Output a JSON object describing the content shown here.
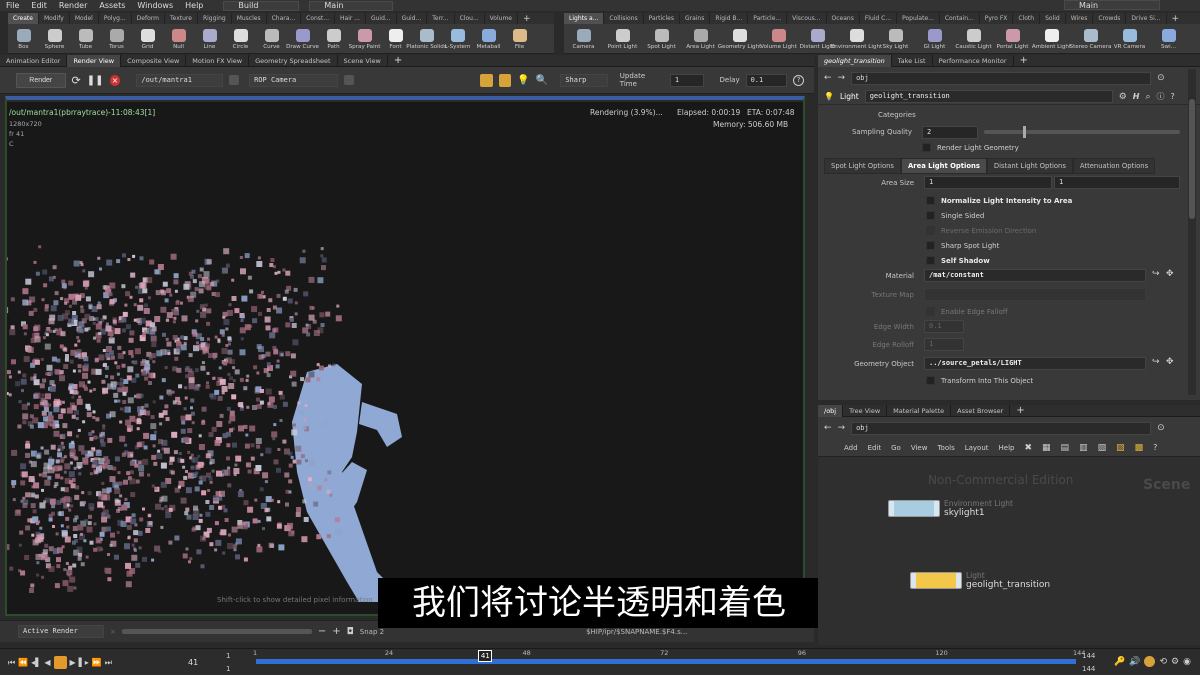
{
  "menubar": {
    "items": [
      "File",
      "Edit",
      "Render",
      "Assets",
      "Windows",
      "Help"
    ],
    "desktop": "Build",
    "layout": "Main",
    "right_layout": "Main"
  },
  "shelf_left": {
    "tabs": [
      "Create",
      "Modify",
      "Model",
      "Polyg...",
      "Deform",
      "Texture",
      "Rigging",
      "Muscles",
      "Chara...",
      "Const...",
      "Hair ...",
      "Guid...",
      "Guid...",
      "Terr...",
      "Clou...",
      "Volume"
    ],
    "tools": [
      "Box",
      "Sphere",
      "Tube",
      "Torus",
      "Grid",
      "Null",
      "Line",
      "Circle",
      "Curve",
      "Draw Curve",
      "Path",
      "Spray Paint",
      "Font",
      "Platonic Solids",
      "L-System",
      "Metaball",
      "File"
    ]
  },
  "shelf_right": {
    "tabs": [
      "Lights a...",
      "Collisions",
      "Particles",
      "Grains",
      "Rigid B...",
      "Particle...",
      "Viscous...",
      "Oceans",
      "Fluid C...",
      "Populate...",
      "Contain...",
      "Pyro FX",
      "Cloth",
      "Solid",
      "Wires",
      "Crowds",
      "Drive Si..."
    ],
    "tools": [
      "Camera",
      "Point Light",
      "Spot Light",
      "Area Light",
      "Geometry Light",
      "Volume Light",
      "Distant Light",
      "Environment Light",
      "Sky Light",
      "GI Light",
      "Caustic Light",
      "Portal Light",
      "Ambient Light",
      "Stereo Camera",
      "VR Camera",
      "Swi..."
    ]
  },
  "left_pane_tabs": [
    "Animation Editor",
    "Render View",
    "Composite View",
    "Motion FX View",
    "Geometry Spreadsheet",
    "Scene View"
  ],
  "render_toolbar": {
    "render_label": "Render",
    "output_path": "/out/mantra1",
    "camera": "ROP Camera",
    "quality": "Sharp",
    "update_time_label": "Update Time",
    "update_time_value": "1",
    "delay_label": "Delay",
    "delay_value": "0.1"
  },
  "viewport": {
    "render_name": "/out/mantra1(pbrraytrace)-11:08:43[1]",
    "resolution": "1280x720",
    "frame": "fr 41",
    "channel": "C",
    "status": "Rendering (3.9%)...",
    "elapsed": "Elapsed: 0:00:19",
    "eta": "ETA: 0:07:48",
    "memory": "Memory: 506.60 MB",
    "hint": "Shift-click to show detailed pixel information"
  },
  "render_bottom": {
    "active_render": "Active Render",
    "snap": "Snap 2",
    "output_file": "$HIP/ipr/$SNAPNAME.$F4.s..."
  },
  "subtitle": "我们将讨论半透明和着色",
  "parm_pane": {
    "tabs": [
      "geolight_transition",
      "Take List",
      "Performance Monitor"
    ],
    "network_path": "obj",
    "node_type": "Light",
    "node_name": "geolight_transition",
    "categories_label": "Categories",
    "sampling_quality_label": "Sampling Quality",
    "sampling_quality_value": "2",
    "sampling_quality_fraction": 0.2,
    "render_light_geometry": "Render Light Geometry",
    "sub_tabs": [
      "Spot Light Options",
      "Area Light Options",
      "Distant Light Options",
      "Attenuation Options"
    ],
    "area_size_label": "Area Size",
    "area_size_x": "1",
    "area_size_y": "1",
    "toggles": [
      {
        "label": "Normalize Light Intensity to Area",
        "enabled": true,
        "bold": true
      },
      {
        "label": "Single Sided",
        "enabled": true,
        "bold": false
      },
      {
        "label": "Reverse Emission Direction",
        "enabled": false,
        "bold": false
      },
      {
        "label": "Sharp Spot Light",
        "enabled": true,
        "bold": false
      },
      {
        "label": "Self Shadow",
        "enabled": true,
        "bold": true
      }
    ],
    "material_label": "Material",
    "material_value": "/mat/constant",
    "texture_map_label": "Texture Map",
    "enable_edge_falloff": "Enable Edge Falloff",
    "edge_width_label": "Edge Width",
    "edge_width_value": "0.1",
    "edge_rolloff_label": "Edge Rolloff",
    "edge_rolloff_value": "1",
    "geometry_object_label": "Geometry Object",
    "geometry_object_value": "../source_petals/LIGHT",
    "transform_into_object": "Transform Into This Object"
  },
  "network_pane": {
    "tabs": [
      "/obj",
      "Tree View",
      "Material Palette",
      "Asset Browser"
    ],
    "path": "obj",
    "menu": [
      "Add",
      "Edit",
      "Go",
      "View",
      "Tools",
      "Layout",
      "Help"
    ],
    "watermark": "Non-Commercial Edition",
    "context_label": "Scene",
    "nodes": [
      {
        "type": "Environment Light",
        "name": "skylight1"
      },
      {
        "type": "Light",
        "name": "geolight_transition"
      }
    ]
  },
  "timeline": {
    "current_frame": "41",
    "start_frame": "1",
    "start_frame2": "1",
    "end_frame": "144",
    "end_frame2": "144",
    "ticks": [
      "1",
      "24",
      "41",
      "48",
      "72",
      "96",
      "120",
      "144"
    ]
  },
  "colors": {
    "accent_blue": "#3b5c9e",
    "timeline_blue": "#2f6fd6",
    "play_orange": "#e39a2a"
  }
}
